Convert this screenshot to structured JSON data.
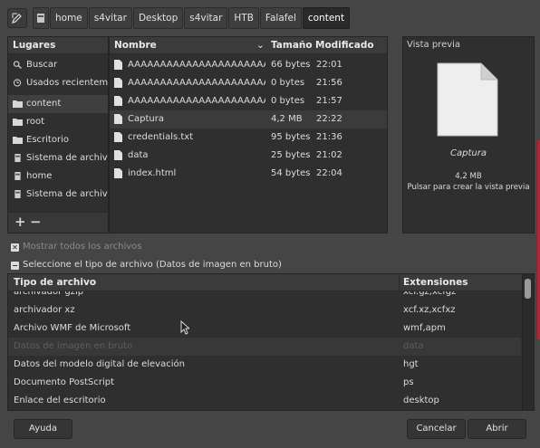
{
  "path_bar": {
    "crumbs": [
      "home",
      "s4vitar",
      "Desktop",
      "s4vitar",
      "HTB",
      "Falafel",
      "content"
    ]
  },
  "places": {
    "header": "Lugares",
    "items": [
      {
        "label": "Buscar",
        "icon": "search-icon"
      },
      {
        "label": "Usados recientemente",
        "icon": "recent-icon"
      },
      {
        "label": "content",
        "icon": "folder-icon"
      },
      {
        "label": "root",
        "icon": "folder-icon"
      },
      {
        "label": "Escritorio",
        "icon": "folder-icon"
      },
      {
        "label": "Sistema de archivos",
        "icon": "drive-icon"
      },
      {
        "label": "home",
        "icon": "drive-icon"
      },
      {
        "label": "Sistema de archivos",
        "icon": "drive-icon"
      }
    ],
    "add_label": "+",
    "remove_label": "−"
  },
  "files": {
    "headers": {
      "name": "Nombre",
      "size": "Tamaño",
      "modified": "Modificado"
    },
    "rows": [
      {
        "name": "AAAAAAAAAAAAAAAAAAAAAAAAAAAA",
        "size": "66 bytes",
        "modified": "22:01"
      },
      {
        "name": "AAAAAAAAAAAAAAAAAAAAAAAAAAAA",
        "size": "0 bytes",
        "modified": "21:56"
      },
      {
        "name": "AAAAAAAAAAAAAAAAAAAAAAAAAAAA",
        "size": "0 bytes",
        "modified": "21:57"
      },
      {
        "name": "Captura",
        "size": "4,2  MB",
        "modified": "22:22"
      },
      {
        "name": "credentials.txt",
        "size": "95 bytes",
        "modified": "21:36"
      },
      {
        "name": "data",
        "size": "25 bytes",
        "modified": "21:02"
      },
      {
        "name": "index.html",
        "size": "54 bytes",
        "modified": "22:04"
      }
    ]
  },
  "preview": {
    "title": "Vista previa",
    "file_name": "Captura",
    "file_size": "4,2  MB",
    "hint": "Pulsar para crear la vista previa"
  },
  "options": {
    "show_all": "Mostrar todos los archivos",
    "select_type": "Seleccione el tipo de archivo (Datos de imagen en bruto)"
  },
  "types": {
    "headers": {
      "type": "Tipo de archivo",
      "ext": "Extensiones"
    },
    "rows": [
      {
        "name": "archivador gzip",
        "ext": "xcf.gz,xcfgz"
      },
      {
        "name": "archivador xz",
        "ext": "xcf.xz,xcfxz"
      },
      {
        "name": "Archivo WMF de Microsoft",
        "ext": "wmf,apm"
      },
      {
        "name": "Datos de imagen en bruto",
        "ext": "data"
      },
      {
        "name": "Datos del modelo digital de elevación",
        "ext": "hgt"
      },
      {
        "name": "Documento PostScript",
        "ext": "ps"
      },
      {
        "name": "Enlace del escritorio",
        "ext": "desktop"
      }
    ]
  },
  "buttons": {
    "help": "Ayuda",
    "cancel": "Cancelar",
    "open": "Abrir"
  }
}
